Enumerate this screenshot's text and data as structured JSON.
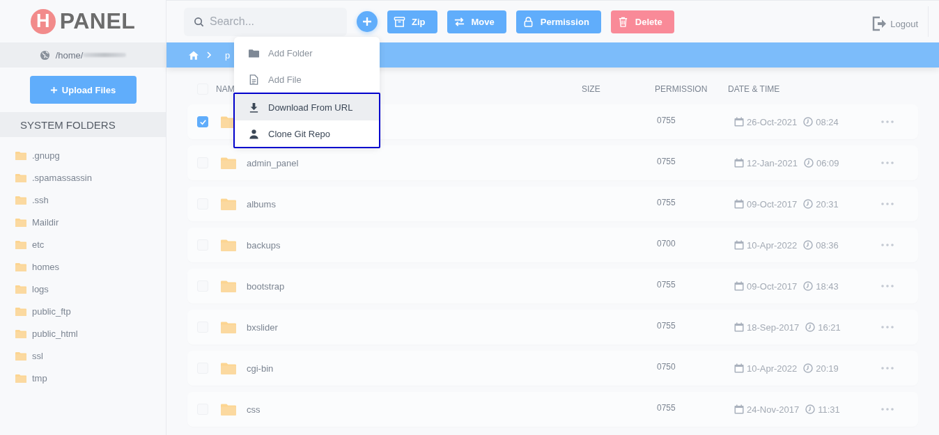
{
  "logo": {
    "letter": "H",
    "text": "PANEL"
  },
  "path": {
    "text": "/home/"
  },
  "upload_button": "Upload Files",
  "sidebar": {
    "title": "SYSTEM FOLDERS",
    "items": [
      {
        "label": ".gnupg"
      },
      {
        "label": ".spamassassin"
      },
      {
        "label": ".ssh"
      },
      {
        "label": "Maildir"
      },
      {
        "label": "etc"
      },
      {
        "label": "homes"
      },
      {
        "label": "logs"
      },
      {
        "label": "public_ftp"
      },
      {
        "label": "public_html"
      },
      {
        "label": "ssl"
      },
      {
        "label": "tmp"
      }
    ]
  },
  "search": {
    "placeholder": "Search..."
  },
  "toolbar": [
    {
      "label": "Zip",
      "kind": "zip"
    },
    {
      "label": "Move",
      "kind": "move"
    },
    {
      "label": "Permission",
      "kind": "permission"
    },
    {
      "label": "Delete",
      "kind": "delete"
    }
  ],
  "logout": "Logout",
  "breadcrumb": [
    {
      "label": "p"
    }
  ],
  "menu": {
    "items": [
      {
        "label": "Add Folder",
        "kind": "folder",
        "hovered": false,
        "framed": false
      },
      {
        "label": "Add File",
        "kind": "file",
        "hovered": false,
        "framed": false
      },
      {
        "label": "Download From URL",
        "kind": "download",
        "hovered": true,
        "framed": true
      },
      {
        "label": "Clone Git Repo",
        "kind": "user",
        "hovered": false,
        "framed": true
      }
    ]
  },
  "table": {
    "columns": [
      "NAM",
      "SIZE",
      "PERMISSION",
      "DATE & TIME"
    ],
    "header_checked": false,
    "rows": [
      {
        "selected": true,
        "permission": "0755",
        "date": "26-Oct-2021",
        "time": "08:24"
      },
      {
        "name": "admin_panel",
        "selected": false,
        "permission": "0755",
        "date": "12-Jan-2021",
        "time": "06:09"
      },
      {
        "name": "albums",
        "selected": false,
        "permission": "0755",
        "date": "09-Oct-2017",
        "time": "20:31"
      },
      {
        "name": "backups",
        "selected": false,
        "permission": "0700",
        "date": "10-Apr-2022",
        "time": "08:36"
      },
      {
        "name": "bootstrap",
        "selected": false,
        "permission": "0755",
        "date": "09-Oct-2017",
        "time": "18:43"
      },
      {
        "name": "bxslider",
        "selected": false,
        "permission": "0755",
        "date": "18-Sep-2017",
        "time": "16:21"
      },
      {
        "name": "cgi-bin",
        "selected": false,
        "permission": "0750",
        "date": "10-Apr-2022",
        "time": "20:19"
      },
      {
        "name": "css",
        "selected": false,
        "permission": "0755",
        "date": "24-Nov-2017",
        "time": "11:31"
      }
    ]
  }
}
